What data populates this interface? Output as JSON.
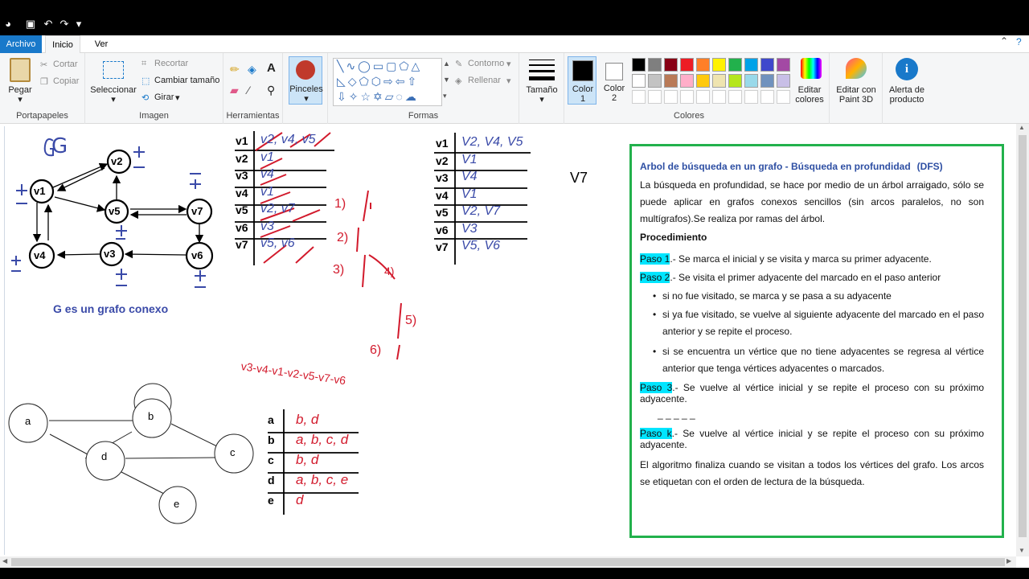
{
  "menus": [
    "Archivo",
    "Inicio",
    "Ver"
  ],
  "ribbon": {
    "clipboard": {
      "paste": "Pegar",
      "cut": "Cortar",
      "copy": "Copiar",
      "label": "Portapapeles"
    },
    "image": {
      "select": "Seleccionar",
      "crop": "Recortar",
      "resize": "Cambiar tamaño",
      "rotate": "Girar",
      "label": "Imagen"
    },
    "tools": {
      "label": "Herramientas"
    },
    "brushes": {
      "label": "Pinceles"
    },
    "shapes": {
      "outline": "Contorno",
      "fill": "Rellenar",
      "label": "Formas"
    },
    "size": {
      "label": "Tamaño"
    },
    "colors": {
      "color1": "Color",
      "color1_num": "1",
      "color2": "Color",
      "color2_num": "2",
      "edit": "Editar",
      "edit2": "colores",
      "label": "Colores",
      "palette": [
        "#000000",
        "#7f7f7f",
        "#880015",
        "#ed1c24",
        "#ff7f27",
        "#fff200",
        "#22b14c",
        "#00a2e8",
        "#3f48cc",
        "#a349a4",
        "#ffffff",
        "#c3c3c3",
        "#b97a57",
        "#ffaec9",
        "#ffc90e",
        "#efe4b0",
        "#b5e61d",
        "#99d9ea",
        "#7092be",
        "#c8bfe7"
      ]
    },
    "paint3d": {
      "line1": "Editar con",
      "line2": "Paint 3D"
    },
    "alert": {
      "line1": "Alerta de",
      "line2": "producto"
    }
  },
  "dfs": {
    "title": "Arbol de búsqueda en un grafo - Búsqueda en profundidad",
    "title_tag": "(DFS)",
    "intro": "La búsqueda en profundidad, se hace por medio de un árbol arraigado, sólo se puede aplicar en grafos conexos sencillos (sin arcos paralelos, no son multígrafos).Se realiza por ramas del árbol.",
    "proc": "Procedimiento",
    "p1_tag": "Paso 1",
    "p1": ".- Se marca el inicial  y se visita y marca su primer adyacente.",
    "p2_tag": "Paso 2",
    "p2": ".-  Se visita el primer adyacente del marcado en el paso anterior",
    "b1": "si no fue visitado, se marca y se pasa a su adyacente",
    "b2": "si ya fue visitado, se vuelve al siguiente adyacente del marcado en el paso anterior y se repite el proceso.",
    "b3": "si se encuentra un vértice que no tiene adyacentes se regresa al vértice anterior que tenga vértices adyacentes o marcados.",
    "p3_tag": "Paso 3",
    "p3": ".-  Se vuelve al vértice inicial y se repite el proceso con su próximo adyacente.",
    "dashes": "_ _ _ _ _",
    "pk_tag": "Paso k",
    "pk": ".- Se vuelve al vértice inicial y se repite el proceso con su próximo adyacente.",
    "end": "El algoritmo finaliza cuando se visitan a todos los vértices del grafo. Los arcos se etiquetan con el orden de lectura de la búsqueda."
  },
  "graph_g": {
    "letter": "G",
    "caption": "G  es un grafo conexo",
    "nodes": [
      "v1",
      "v2",
      "v5",
      "v7",
      "v4",
      "v3",
      "v6"
    ]
  },
  "table1": {
    "rows": [
      {
        "k": "v1",
        "v": "v2, v4, v5"
      },
      {
        "k": "v2",
        "v": "v1"
      },
      {
        "k": "v3",
        "v": "v4"
      },
      {
        "k": "v4",
        "v": "v1"
      },
      {
        "k": "v5",
        "v": "v2, v7"
      },
      {
        "k": "v6",
        "v": "v3"
      },
      {
        "k": "v7",
        "v": "v5, v6"
      }
    ]
  },
  "table2": {
    "rows": [
      {
        "k": "v1",
        "v": "V2, V4, V5"
      },
      {
        "k": "v2",
        "v": "V1"
      },
      {
        "k": "v3",
        "v": "V4"
      },
      {
        "k": "v4",
        "v": "V1"
      },
      {
        "k": "v5",
        "v": "V2, V7"
      },
      {
        "k": "v6",
        "v": "V3"
      },
      {
        "k": "v7",
        "v": "V5, V6"
      }
    ]
  },
  "steps": {
    "s1": "1)",
    "s2": "2)",
    "s3": "3)",
    "s4": "4)",
    "s5": "5)",
    "s6": "6)",
    "path": "v3-v4-v1-v2-v5-v7-v6",
    "v7note": "V7"
  },
  "graph2": {
    "nodes": [
      "a",
      "b",
      "c",
      "d",
      "e"
    ]
  },
  "table3": {
    "rows": [
      {
        "k": "a",
        "v": "b, d"
      },
      {
        "k": "b",
        "v": "a, b, c, d"
      },
      {
        "k": "c",
        "v": "b, d"
      },
      {
        "k": "d",
        "v": "a, b, c, e"
      },
      {
        "k": "e",
        "v": "d"
      }
    ]
  }
}
